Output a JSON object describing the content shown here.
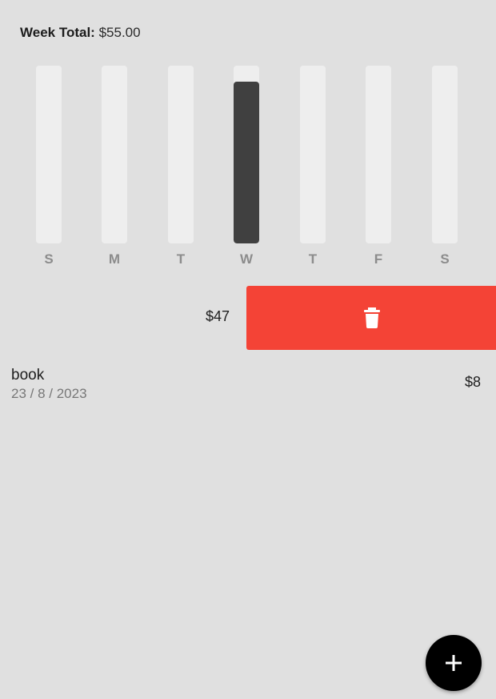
{
  "header": {
    "week_total_label": "Week Total:",
    "week_total_amount": "$55.00"
  },
  "chart_data": {
    "type": "bar",
    "categories": [
      "S",
      "M",
      "T",
      "W",
      "T",
      "F",
      "S"
    ],
    "fill_fraction": [
      0,
      0,
      0,
      0.91,
      0,
      0,
      0
    ],
    "track_color": "#eeeeee",
    "fill_color": "#404040"
  },
  "transactions": [
    {
      "amount": "$47",
      "swiped": true,
      "action": "delete",
      "action_color": "#f44336",
      "action_icon": "trash-icon"
    },
    {
      "title": "book",
      "date": "23 / 8 / 2023",
      "amount": "$8"
    }
  ],
  "fab": {
    "icon": "plus-icon",
    "color": "#000000"
  }
}
